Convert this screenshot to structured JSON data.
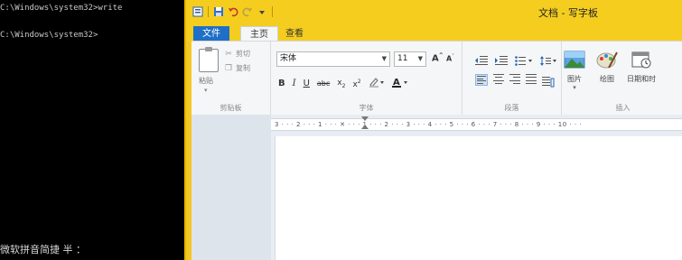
{
  "console": {
    "line1": "C:\\Windows\\system32>write",
    "line2": "C:\\Windows\\system32>",
    "ime_status": "微软拼音简捷 半 ："
  },
  "wordpad": {
    "title": "文档 - 写字板",
    "tabs": [
      "文件",
      "主页",
      "查看"
    ],
    "clipboard": {
      "paste": "粘贴",
      "cut": "剪切",
      "copy": "复制",
      "group": "剪贴板"
    },
    "font": {
      "name": "宋体",
      "size": "11",
      "group": "字体"
    },
    "paragraph": {
      "group": "段落"
    },
    "insert": {
      "picture": "图片",
      "paint": "绘图",
      "datetime": "日期和时",
      "group": "插入"
    },
    "ruler": "3 · · · 2 · · · 1 · · · ✕ · · · 1 · · · 2 · · · 3 · · · 4 · · · 5 · · · 6 · · · 7 · · · 8 · · · 9 · · · 10 · · ·"
  },
  "colors": {
    "titlebar": "#f5cd1f",
    "file_tab": "#1e6fc7",
    "ribbon": "#f5f6f7",
    "console_bg": "#000000"
  }
}
